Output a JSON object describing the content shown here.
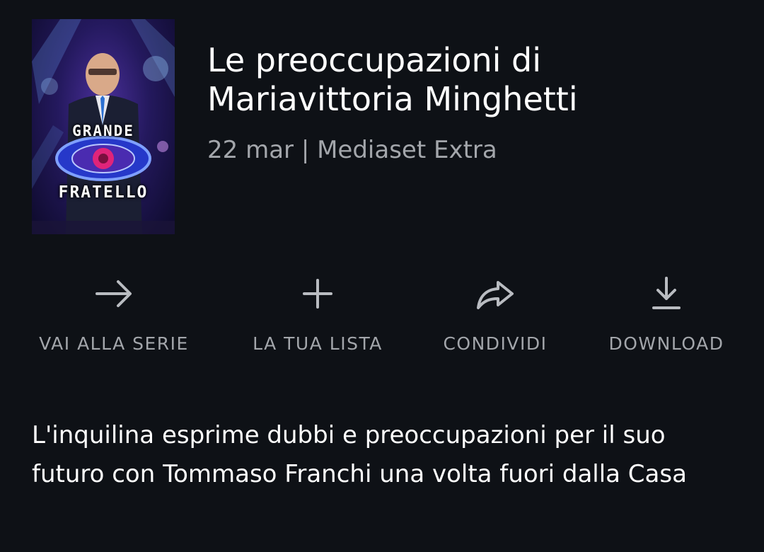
{
  "poster": {
    "word_top": "GRANDE",
    "word_bottom": "FRATELLO"
  },
  "episode": {
    "title": "Le preoccupazioni di Mariavittoria Minghetti",
    "meta": "22 mar | Mediaset Extra",
    "description": "L'inquilina esprime dubbi e preoccupazioni per il suo futuro con Tommaso Franchi una volta fuori dalla Casa"
  },
  "actions": [
    {
      "label": "VAI ALLA SERIE",
      "icon": "arrow-right-icon"
    },
    {
      "label": "LA TUA LISTA",
      "icon": "plus-icon"
    },
    {
      "label": "CONDIVIDI",
      "icon": "share-icon"
    },
    {
      "label": "DOWNLOAD",
      "icon": "download-icon"
    }
  ],
  "colors": {
    "background": "#0e1116",
    "primary_text": "#ffffff",
    "secondary_text": "#a3a6ab",
    "icon": "#b9bcc1"
  }
}
